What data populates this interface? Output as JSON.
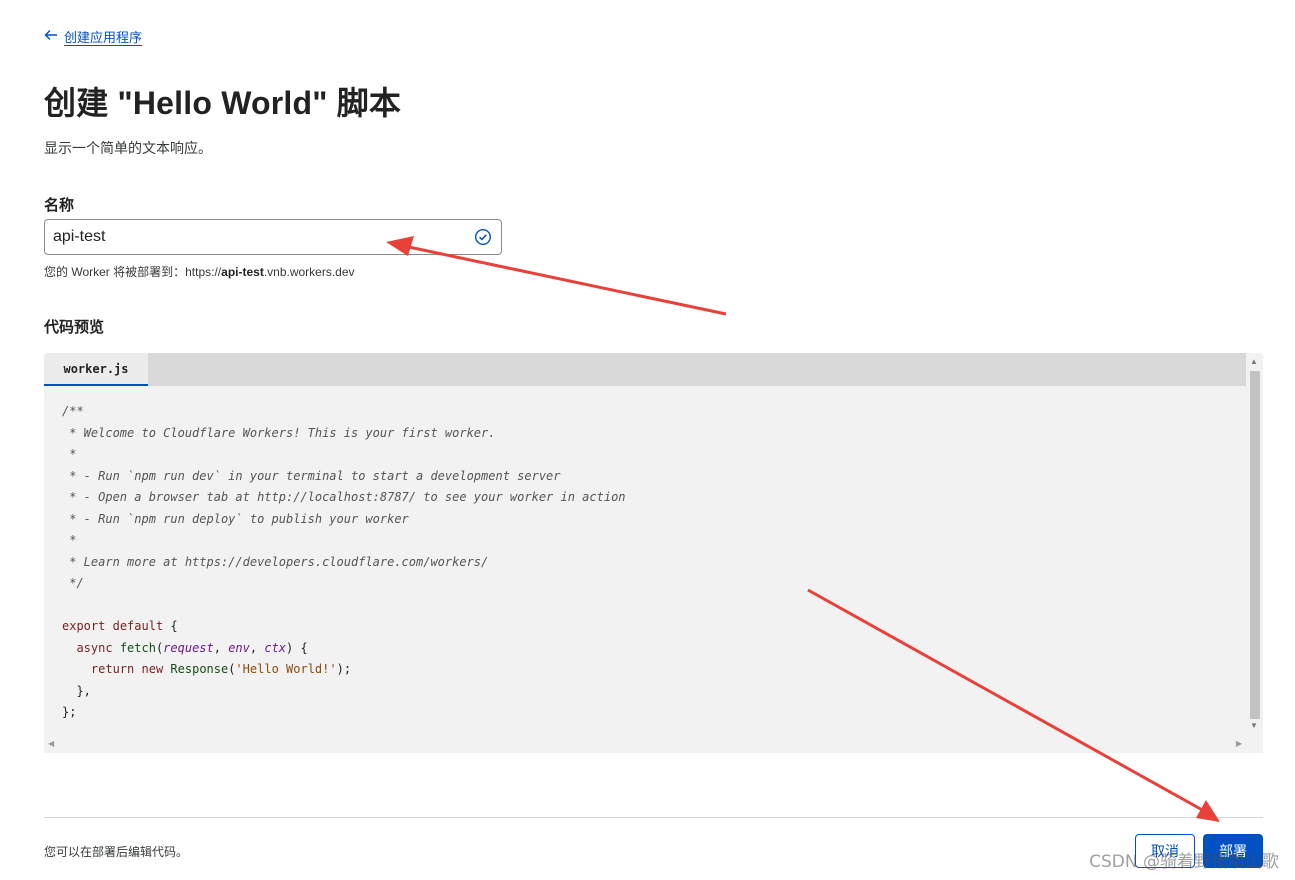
{
  "back_link": {
    "label": "创建应用程序"
  },
  "header": {
    "title": "创建 \"Hello World\" 脚本",
    "subtitle": "显示一个简单的文本响应。"
  },
  "name_field": {
    "label": "名称",
    "value": "api-test",
    "hint_prefix": "您的 Worker 将被部署到：https://",
    "hint_bold": "api-test",
    "hint_suffix": ".vnb.workers.dev"
  },
  "code_preview": {
    "label": "代码预览",
    "tab": "worker.js",
    "lines": [
      "/**",
      " * Welcome to Cloudflare Workers! This is your first worker.",
      " *",
      " * - Run `npm run dev` in your terminal to start a development server",
      " * - Open a browser tab at http://localhost:8787/ to see your worker in action",
      " * - Run `npm run deploy` to publish your worker",
      " *",
      " * Learn more at https://developers.cloudflare.com/workers/",
      " */",
      "",
      "export default {",
      "  async fetch(request, env, ctx) {",
      "    return new Response('Hello World!');",
      "  },",
      "};"
    ]
  },
  "footer": {
    "note": "您可以在部署后编辑代码。",
    "cancel_label": "取消",
    "deploy_label": "部署"
  },
  "watermark": "CSDN @骑着野猪唱山歌",
  "colors": {
    "accent": "#0051c3",
    "annotation_arrow": "#e8413a"
  }
}
